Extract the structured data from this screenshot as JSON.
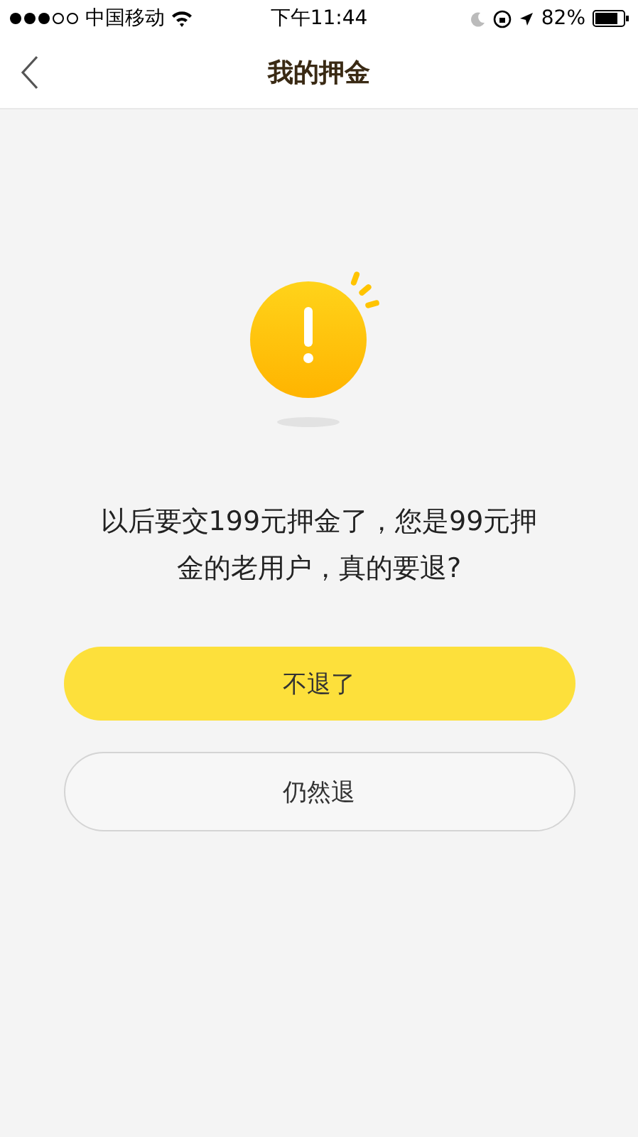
{
  "status_bar": {
    "carrier": "中国移动",
    "time": "下午11:44",
    "battery": "82%"
  },
  "nav": {
    "title": "我的押金"
  },
  "message": "以后要交199元押金了，您是99元押金的老用户，真的要退?",
  "buttons": [
    {
      "label": "不退了",
      "kind": "primary"
    },
    {
      "label": "仍然退",
      "kind": "secondary"
    }
  ]
}
